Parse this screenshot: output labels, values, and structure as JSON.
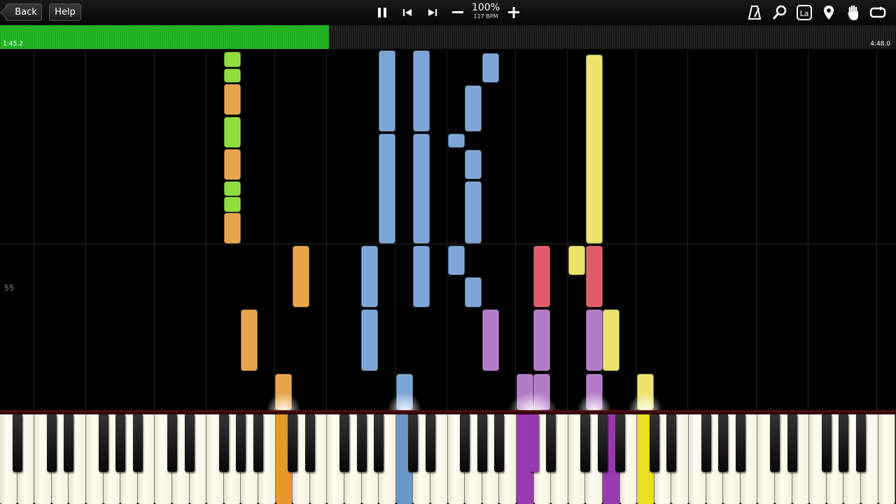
{
  "toolbar": {
    "back_label": "Back",
    "help_label": "Help",
    "speed_percent": "100%",
    "speed_bpm": "117 BPM"
  },
  "progress": {
    "elapsed": "1:45.2",
    "total": "4:48.0",
    "fraction": 0.367
  },
  "measure_number": "55",
  "colors": {
    "orange": "#e8a44a",
    "green": "#8edc3c",
    "blue": "#7ba5d6",
    "yellow": "#ede36a",
    "red": "#e05c6a",
    "purple": "#b47cc8",
    "progress": "#28c628"
  },
  "pressed_keys": [
    {
      "color": "#e8982a"
    },
    {
      "color": "#6a98c8"
    },
    {
      "color": "#9a3ab0"
    },
    {
      "color": "#9a3ab0"
    },
    {
      "color": "#9a3ab0"
    },
    {
      "color": "#e8e020"
    }
  ]
}
